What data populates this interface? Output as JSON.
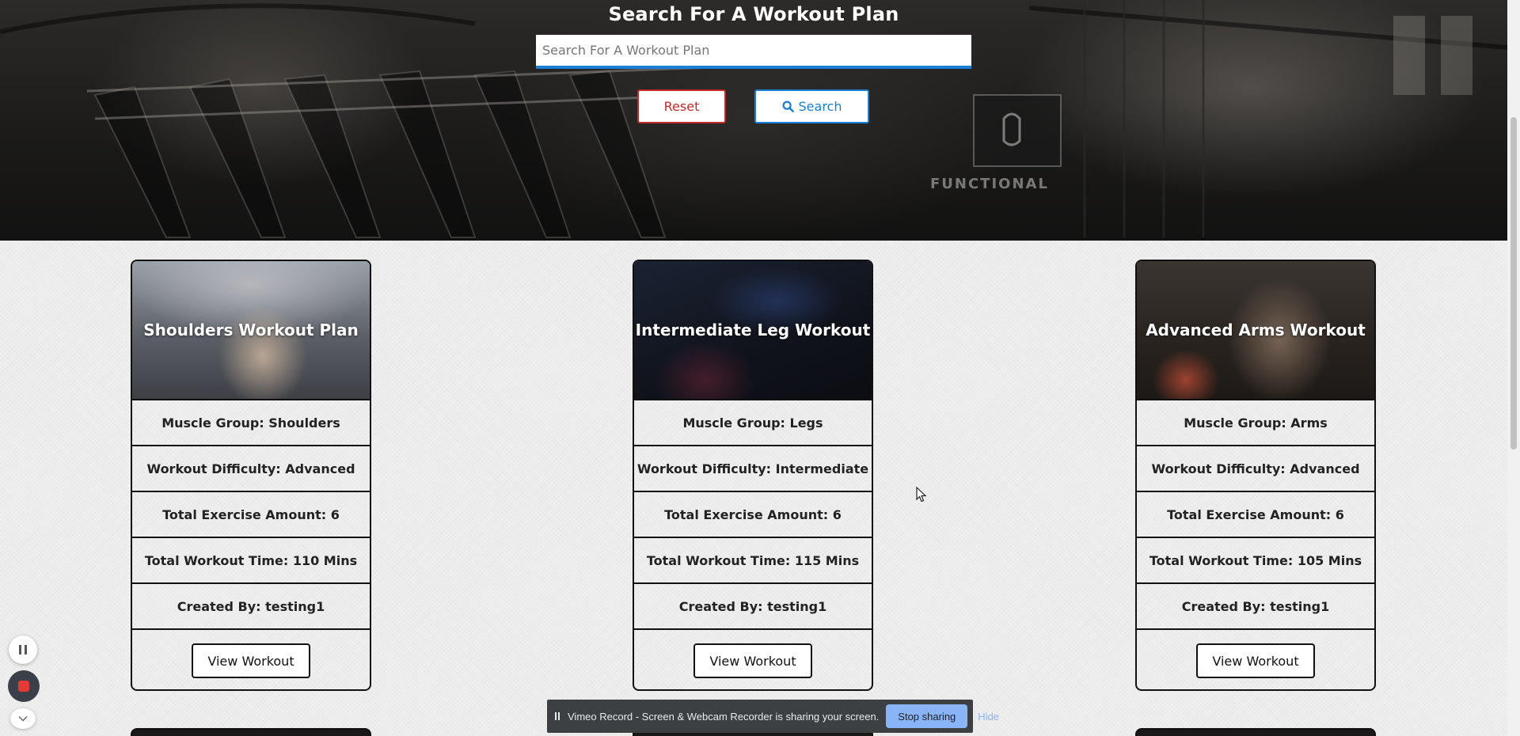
{
  "hero": {
    "title": "Search For A Workout Plan",
    "search_placeholder": "Search For A Workout Plan",
    "reset_label": "Reset",
    "search_label": "Search",
    "background_text": "FUNCTIONAL"
  },
  "cards": [
    {
      "title": "Shoulders Workout Plan",
      "muscle_group": "Muscle Group: Shoulders",
      "difficulty": "Workout Difficulty: Advanced",
      "exercise_amount": "Total Exercise Amount: 6",
      "workout_time": "Total Workout Time: 110 Mins",
      "created_by": "Created By: testing1",
      "button_label": "View Workout"
    },
    {
      "title": "Intermediate Leg Workout",
      "muscle_group": "Muscle Group: Legs",
      "difficulty": "Workout Difficulty: Intermediate",
      "exercise_amount": "Total Exercise Amount: 6",
      "workout_time": "Total Workout Time: 115 Mins",
      "created_by": "Created By: testing1",
      "button_label": "View Workout"
    },
    {
      "title": "Advanced Arms Workout",
      "muscle_group": "Muscle Group: Arms",
      "difficulty": "Workout Difficulty: Advanced",
      "exercise_amount": "Total Exercise Amount: 6",
      "workout_time": "Total Workout Time: 105 Mins",
      "created_by": "Created By: testing1",
      "button_label": "View Workout"
    }
  ],
  "recorder": {
    "sharing_text": "Vimeo Record - Screen & Webcam Recorder is sharing your screen.",
    "stop_sharing_label": "Stop sharing",
    "hide_label": "Hide"
  },
  "colors": {
    "accent_blue": "#1a7fd6",
    "reset_red": "#c62828",
    "share_bar_bg": "#3c4043",
    "stop_button_bg": "#8ab4f8"
  },
  "icons": [
    "search-icon",
    "pause-icon",
    "stop-record-icon",
    "chevron-down-icon",
    "mouse-cursor-icon"
  ]
}
